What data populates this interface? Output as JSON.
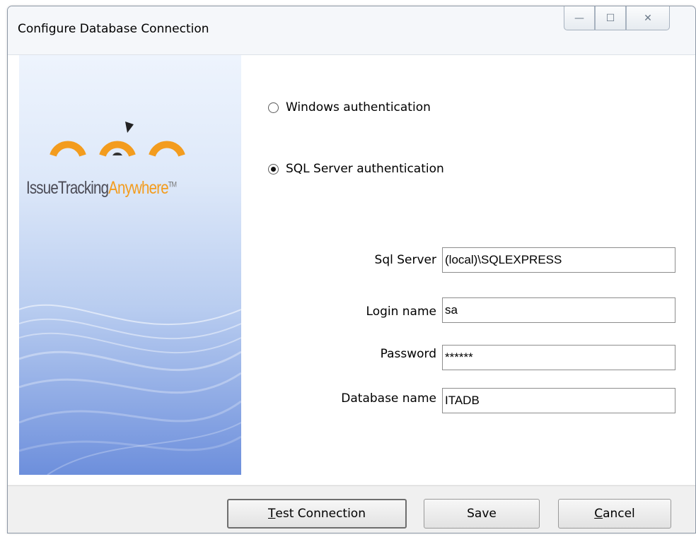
{
  "window": {
    "title": "Configure Database Connection",
    "controls": {
      "minimize": "—",
      "maximize": "☐",
      "close": "✕"
    }
  },
  "banner": {
    "logo_part1": "IssueTracking",
    "logo_part2": "Anywhere",
    "trademark": "TM",
    "colors": {
      "brand_orange": "#f39c1e",
      "logo_gray": "#4a4a55"
    }
  },
  "auth": {
    "windows_label": "Windows authentication",
    "sql_label": "SQL Server authentication",
    "selected": "sql"
  },
  "fields": {
    "sql_server": {
      "label": "Sql Server",
      "value": "(local)\\SQLEXPRESS"
    },
    "login_name": {
      "label": "Login name",
      "value": "sa"
    },
    "password": {
      "label": "Password",
      "value": "******"
    },
    "database_name": {
      "label": "Database name",
      "value": "ITADB"
    }
  },
  "buttons": {
    "test_first": "T",
    "test_rest": "est Connection",
    "save": "Save",
    "cancel_first": "C",
    "cancel_rest": "ancel"
  }
}
